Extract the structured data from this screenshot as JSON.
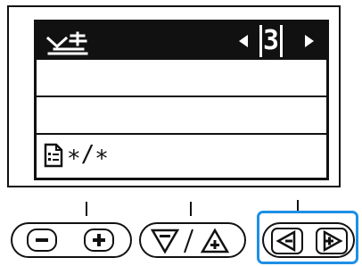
{
  "display": {
    "header": {
      "icon": "sewing-machine-pattern-icon",
      "page_number": "3",
      "left_arrow": "triangle-left-icon",
      "right_arrow": "triangle-right-icon"
    },
    "footer": {
      "icon": "document-list-icon",
      "text": "∗/∗"
    }
  },
  "buttons": {
    "minus_key": "minus-icon",
    "plus_key": "plus-icon",
    "down_key": "triangle-down-minus-icon",
    "up_key": "triangle-up-plus-icon",
    "left_key": "triangle-left-minus-icon",
    "right_key": "triangle-right-plus-icon",
    "divider_text": "/"
  },
  "colors": {
    "highlight": "#1e8fe6",
    "lcd_ink": "#111111"
  }
}
